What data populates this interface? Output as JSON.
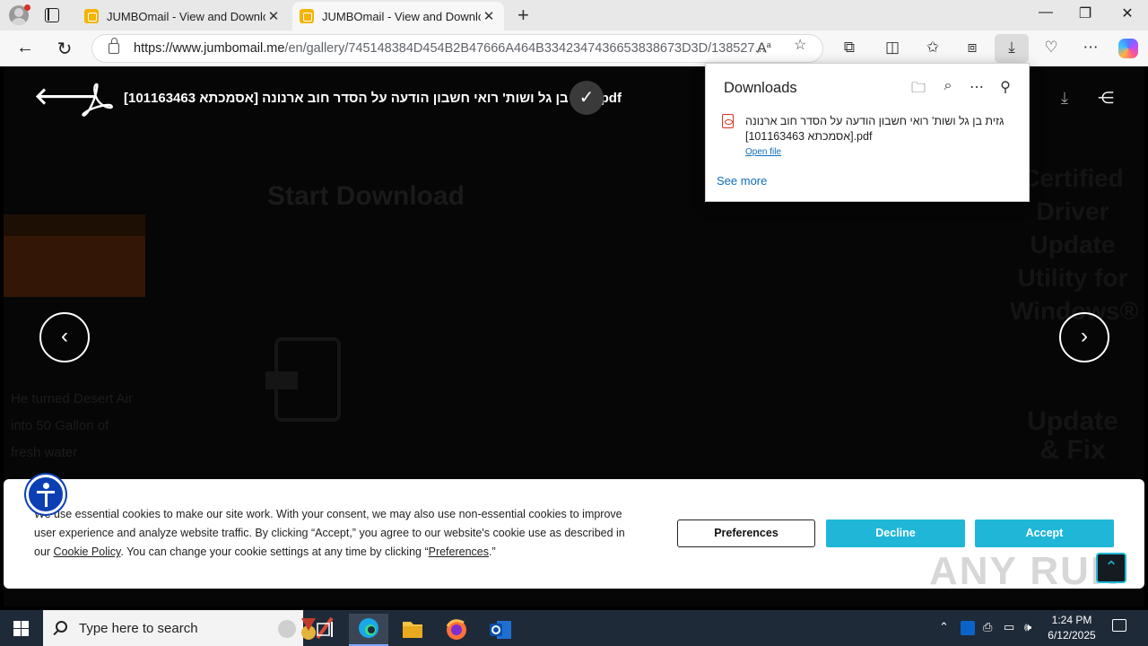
{
  "browser": {
    "tabs": [
      {
        "title": "JUMBOmail - View and Download",
        "active": false
      },
      {
        "title": "JUMBOmail - View and Download",
        "active": true
      }
    ],
    "url_host": "https://www.jumbomail.me",
    "url_path": "/en/gallery/745148384D454B2B47666A464B3342347436653838673D3D/138527..."
  },
  "viewer": {
    "file_name": "גזית בן גל ושות' רואי חשבון הודעה על הסדר חוב ארנונה [אסמכתא 101163463].pdf",
    "background_heading": "Start Download",
    "background_ad_left": "He turned Desert Air into 50 Gallon of fresh water",
    "background_ad_right": "Certified Driver Update Utility for Windows®",
    "background_ad_right_cta": "Update & Fix"
  },
  "downloads_panel": {
    "title": "Downloads",
    "item_name": "גזית בן גל ושות' רואי חשבון הודעה על הסדר חוב ארנונה [אסמכתא 101163463].pdf",
    "open_file": "Open file",
    "see_more": "See more"
  },
  "cookie_banner": {
    "text_part1": "We use essential cookies to make our site work. With your consent, we may also use non-essential cookies to improve user experience and analyze website traffic. By clicking “Accept,” you agree to our website's cookie use as described in our ",
    "cookie_policy_link": "Cookie Policy",
    "text_part2": ". You can change your cookie settings at any time by clicking “",
    "preferences_link": "Preferences",
    "text_part3": ".”",
    "preferences_button": "Preferences",
    "decline_button": "Decline",
    "accept_button": "Accept"
  },
  "watermark": "ANY RUN",
  "taskbar": {
    "search_placeholder": "Type here to search",
    "time": "1:24 PM",
    "date": "6/12/2025"
  },
  "colors": {
    "accent_button": "#1fb6d8",
    "link": "#0f6cbd",
    "taskbar": "#1f2a39"
  }
}
